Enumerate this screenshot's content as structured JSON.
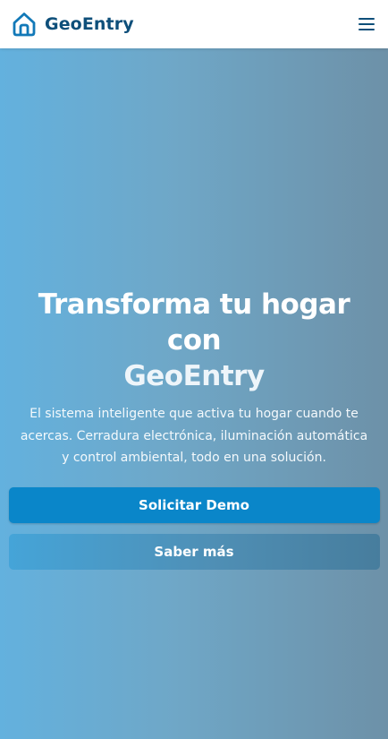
{
  "header": {
    "brand_name": "GeoEntry",
    "brand_icon": "house-icon",
    "menu_icon": "hamburger-menu-icon"
  },
  "hero": {
    "title_line1": "Transforma tu hogar",
    "title_line2": "con",
    "title_line3": "GeoEntry",
    "subtitle": "El sistema inteligente que activa tu hogar cuando te acercas. Cerradura electrónica, iluminación automática y control ambiental, todo en una solución.",
    "primary_button": "Solicitar Demo",
    "secondary_button": "Saber más"
  },
  "colors": {
    "brand": "#0e4f7a",
    "primary_button": "#0a86c9",
    "hero_gradient_start": "#63b1de",
    "hero_gradient_end": "#6d91a8"
  }
}
